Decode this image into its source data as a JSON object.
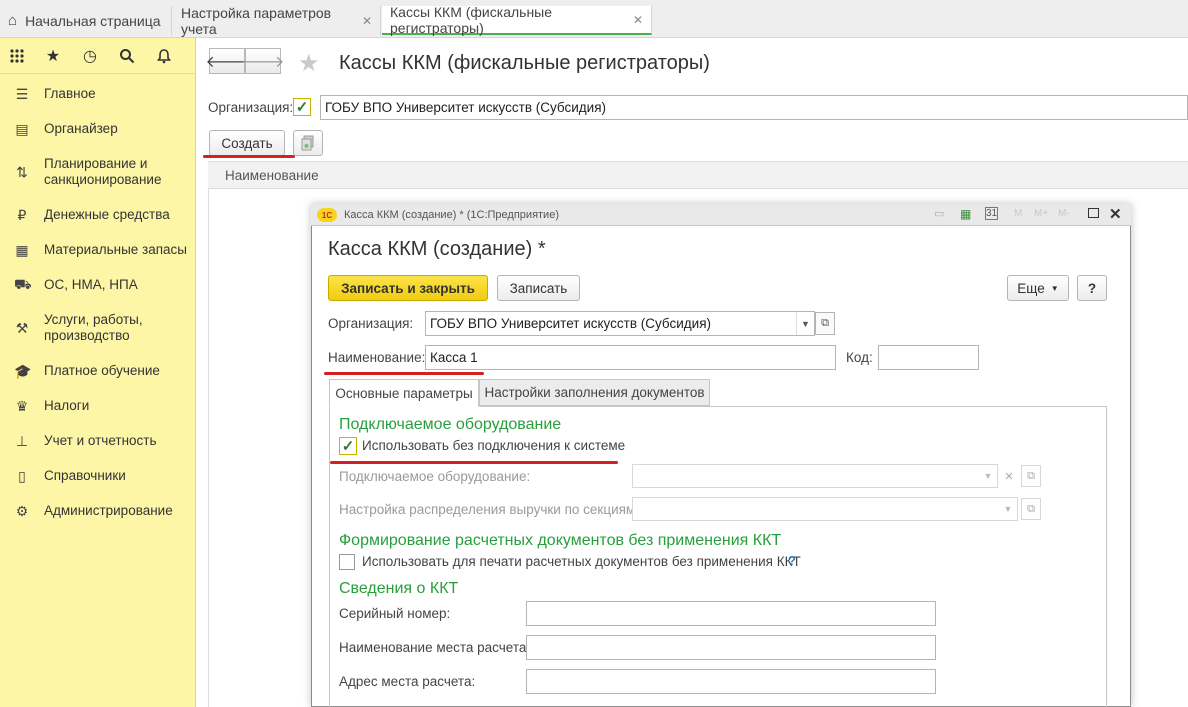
{
  "tabs": [
    {
      "label": "Начальная страница"
    },
    {
      "label": "Настройка параметров учета",
      "close": "✕"
    },
    {
      "label": "Кассы ККМ (фискальные регистраторы)",
      "close": "✕"
    }
  ],
  "sidebar": {
    "items": [
      {
        "label": "Главное"
      },
      {
        "label": "Органайзер"
      },
      {
        "label": "Планирование и санкционирование"
      },
      {
        "label": "Денежные средства"
      },
      {
        "label": "Материальные запасы"
      },
      {
        "label": "ОС, НМА, НПА"
      },
      {
        "label": "Услуги, работы, производство"
      },
      {
        "label": "Платное обучение"
      },
      {
        "label": "Налоги"
      },
      {
        "label": "Учет и отчетность"
      },
      {
        "label": "Справочники"
      },
      {
        "label": "Администрирование"
      }
    ]
  },
  "main": {
    "title": "Кассы ККМ (фискальные регистраторы)",
    "org_label": "Организация:",
    "org_value": "ГОБУ ВПО Университет искусств (Субсидия)",
    "create_button": "Создать",
    "column_header": "Наименование"
  },
  "modal": {
    "window_title": "Касса ККМ (создание) * (1С:Предприятие)",
    "heading": "Касса ККМ (создание) *",
    "save_close": "Записать и закрыть",
    "save": "Записать",
    "more": "Еще",
    "help": "?",
    "org_label": "Организация:",
    "org_value": "ГОБУ ВПО Университет искусств (Субсидия)",
    "name_label": "Наименование:",
    "name_value": "Касса 1",
    "code_label": "Код:",
    "code_value": "",
    "tabs": [
      {
        "label": "Основные параметры"
      },
      {
        "label": "Настройки заполнения документов"
      }
    ],
    "section1": "Подключаемое оборудование",
    "use_without_connection": "Использовать без подключения к системе",
    "equipment_label": "Подключаемое оборудование:",
    "revenue_label": "Настройка распределения выручки по секциям:",
    "section2": "Формирование расчетных документов без применения ККТ",
    "use_for_print": "Использовать для печати расчетных документов без применения ККТ",
    "help_q": "?",
    "section3": "Сведения о ККТ",
    "serial_label": "Серийный номер:",
    "place_name_label": "Наименование места расчета:",
    "place_address_label": "Адрес места расчета:"
  },
  "colors": {
    "sidebar_bg": "#fdf6a6",
    "accent_green": "#27a03c",
    "primary_button": "#f7d51c",
    "annotation_red": "#d32020"
  }
}
